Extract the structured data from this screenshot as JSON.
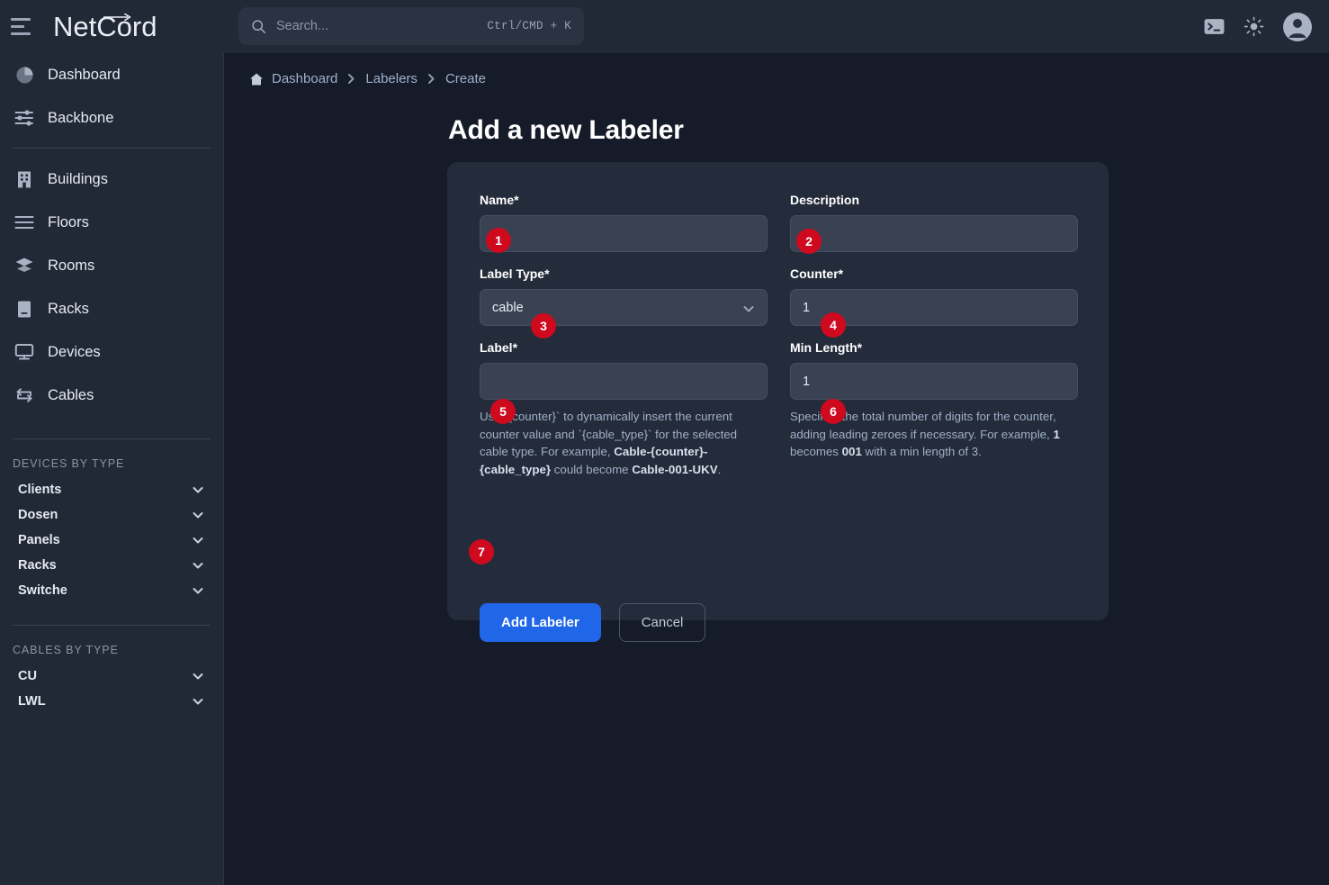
{
  "app": {
    "logo_text": "NetCord",
    "logo_part_a": "NetC",
    "logo_part_b": "or",
    "logo_part_c": "d"
  },
  "topbar": {
    "menu_icon": "hamburger-icon",
    "terminal_icon": "terminal-icon",
    "theme_icon": "sun-icon",
    "avatar_icon": "user-avatar-icon"
  },
  "search": {
    "placeholder": "Search...",
    "shortcut": "Ctrl/CMD + K",
    "icon": "search-icon"
  },
  "sidebar": {
    "primary": [
      {
        "label": "Dashboard",
        "icon": "pie-chart-icon"
      },
      {
        "label": "Backbone",
        "icon": "sliders-icon"
      }
    ],
    "secondary": [
      {
        "label": "Buildings",
        "icon": "building-icon"
      },
      {
        "label": "Floors",
        "icon": "floors-lines-icon"
      },
      {
        "label": "Rooms",
        "icon": "layers-icon"
      },
      {
        "label": "Racks",
        "icon": "rack-icon"
      },
      {
        "label": "Devices",
        "icon": "monitor-icon"
      },
      {
        "label": "Cables",
        "icon": "exchange-arrows-icon"
      }
    ],
    "devices_section": {
      "title": "DEVICES BY TYPE",
      "items": [
        {
          "label": "Clients",
          "chevron": "chevron-down-icon"
        },
        {
          "label": "Dosen",
          "chevron": "chevron-down-icon"
        },
        {
          "label": "Panels",
          "chevron": "chevron-down-icon"
        },
        {
          "label": "Racks",
          "chevron": "chevron-down-icon"
        },
        {
          "label": "Switche",
          "chevron": "chevron-down-icon"
        }
      ]
    },
    "cables_section": {
      "title": "CABLES BY TYPE",
      "items": [
        {
          "label": "CU",
          "chevron": "chevron-down-icon"
        },
        {
          "label": "LWL",
          "chevron": "chevron-down-icon"
        }
      ]
    }
  },
  "breadcrumb": {
    "home_icon": "home-icon",
    "items": [
      "Dashboard",
      "Labelers",
      "Create"
    ],
    "separator": "chevron-right-icon"
  },
  "page": {
    "title": "Add a new Labeler"
  },
  "form": {
    "name": {
      "label": "Name*",
      "value": "",
      "placeholder": ""
    },
    "description": {
      "label": "Description",
      "value": "",
      "placeholder": ""
    },
    "label_type": {
      "label": "Label Type*",
      "value": "cable",
      "chevron": "chevron-down-icon",
      "options": [
        "cable"
      ]
    },
    "counter": {
      "label": "Counter*",
      "value": "1"
    },
    "label": {
      "label": "Label*",
      "value": "",
      "placeholder": ""
    },
    "min_length": {
      "label": "Min Length*",
      "value": "1"
    },
    "label_help": {
      "p1": "Use `{counter}` to dynamically insert the current counter value and `{cable_type}` for the selected cable type. For example, ",
      "b1": "Cable-{counter}-{cable_type}",
      "p2": " could become ",
      "b2": "Cable-001-UKV",
      "p3": "."
    },
    "min_length_help": {
      "p1": "Specifies the total number of digits for the counter, adding leading zeroes if necessary. For example, ",
      "b1": "1",
      "p2": " becomes ",
      "b2": "001",
      "p3": " with a min length of 3."
    },
    "submit_label": "Add Labeler",
    "cancel_label": "Cancel"
  },
  "annotations": [
    {
      "num": "1"
    },
    {
      "num": "2"
    },
    {
      "num": "3"
    },
    {
      "num": "4"
    },
    {
      "num": "5"
    },
    {
      "num": "6"
    },
    {
      "num": "7"
    }
  ],
  "colors": {
    "accent": "#1f66e8",
    "badge": "#cf0a1e",
    "page_bg": "#151b28",
    "panel_bg": "#212836",
    "card_bg": "#242b3a",
    "input_bg": "#394152"
  }
}
